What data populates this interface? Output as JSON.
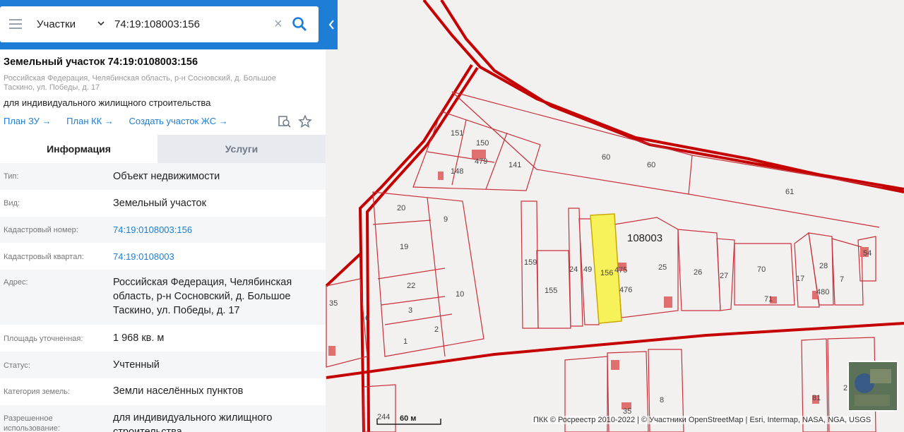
{
  "search": {
    "type_label": "Участки",
    "query": "74:19:108003:156"
  },
  "object": {
    "title": "Земельный участок 74:19:0108003:156",
    "address_line": "Российская Федерация, Челябинская область, р-н Сосновский, д. Большое Таскино, ул. Победы, д. 17",
    "purpose": "для индивидуального жилищного строительства",
    "links": [
      "План ЗУ →",
      "План КК →",
      "Создать участок ЖС →"
    ]
  },
  "tabs": [
    "Информация",
    "Услуги"
  ],
  "info_rows": [
    {
      "key": "Тип:",
      "value": "Объект недвижимости"
    },
    {
      "key": "Вид:",
      "value": "Земельный участок"
    },
    {
      "key": "Кадастровый номер:",
      "value": "74:19:0108003:156"
    },
    {
      "key": "Кадастровый квартал:",
      "value": "74:19:0108003"
    },
    {
      "key": "Адрес:",
      "value": "Российская Федерация, Челябинская область, р-н Сосновский, д. Большое Таскино, ул. Победы, д. 17"
    },
    {
      "key": "Площадь уточненная:",
      "value": "1 968 кв. м"
    },
    {
      "key": "Статус:",
      "value": "Учтенный"
    },
    {
      "key": "Категория земель:",
      "value": "Земли населённых пунктов"
    },
    {
      "key": "Разрешенное использование:",
      "value": "для индивидуального жилищного строительства"
    }
  ],
  "map": {
    "quarter_label": "108003",
    "parcel_labels": [
      "151",
      "150",
      "479",
      "141",
      "148",
      "60",
      "60",
      "61",
      "20",
      "9",
      "19",
      "22",
      "10",
      "3",
      "2",
      "1",
      "6",
      "35",
      "159",
      "155",
      "24",
      "49",
      "156",
      "475",
      "476",
      "25",
      "26",
      "27",
      "70",
      "71",
      "17",
      "28",
      "480",
      "7",
      "54",
      "244",
      "35",
      "8",
      "81",
      "2"
    ],
    "scale_label": "60 м",
    "attribution": "ПКК © Росреестр 2010-2022 | © Участники OpenStreetMap | Esri, Intermap, NASA, NGA, USGS",
    "colors": {
      "boundary": "#c40000",
      "parcel_line": "#c8303a",
      "selected_fill": "#f7f15a",
      "building": "#e07070"
    }
  }
}
